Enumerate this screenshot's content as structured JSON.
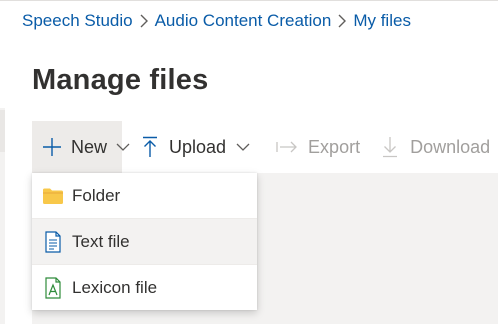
{
  "breadcrumb": {
    "items": [
      "Speech Studio",
      "Audio Content Creation",
      "My files"
    ]
  },
  "page": {
    "title": "Manage files"
  },
  "toolbar": {
    "new_label": "New",
    "upload_label": "Upload",
    "export_label": "Export",
    "download_label": "Download"
  },
  "new_menu": {
    "items": [
      {
        "label": "Folder",
        "icon": "folder-icon"
      },
      {
        "label": "Text file",
        "icon": "text-file-icon"
      },
      {
        "label": "Lexicon file",
        "icon": "lexicon-file-icon"
      }
    ]
  },
  "colors": {
    "accent": "#0a5ca8",
    "folder": "#f8c84a",
    "lexicon": "#2e8b3a",
    "disabled": "#a19f9d"
  }
}
